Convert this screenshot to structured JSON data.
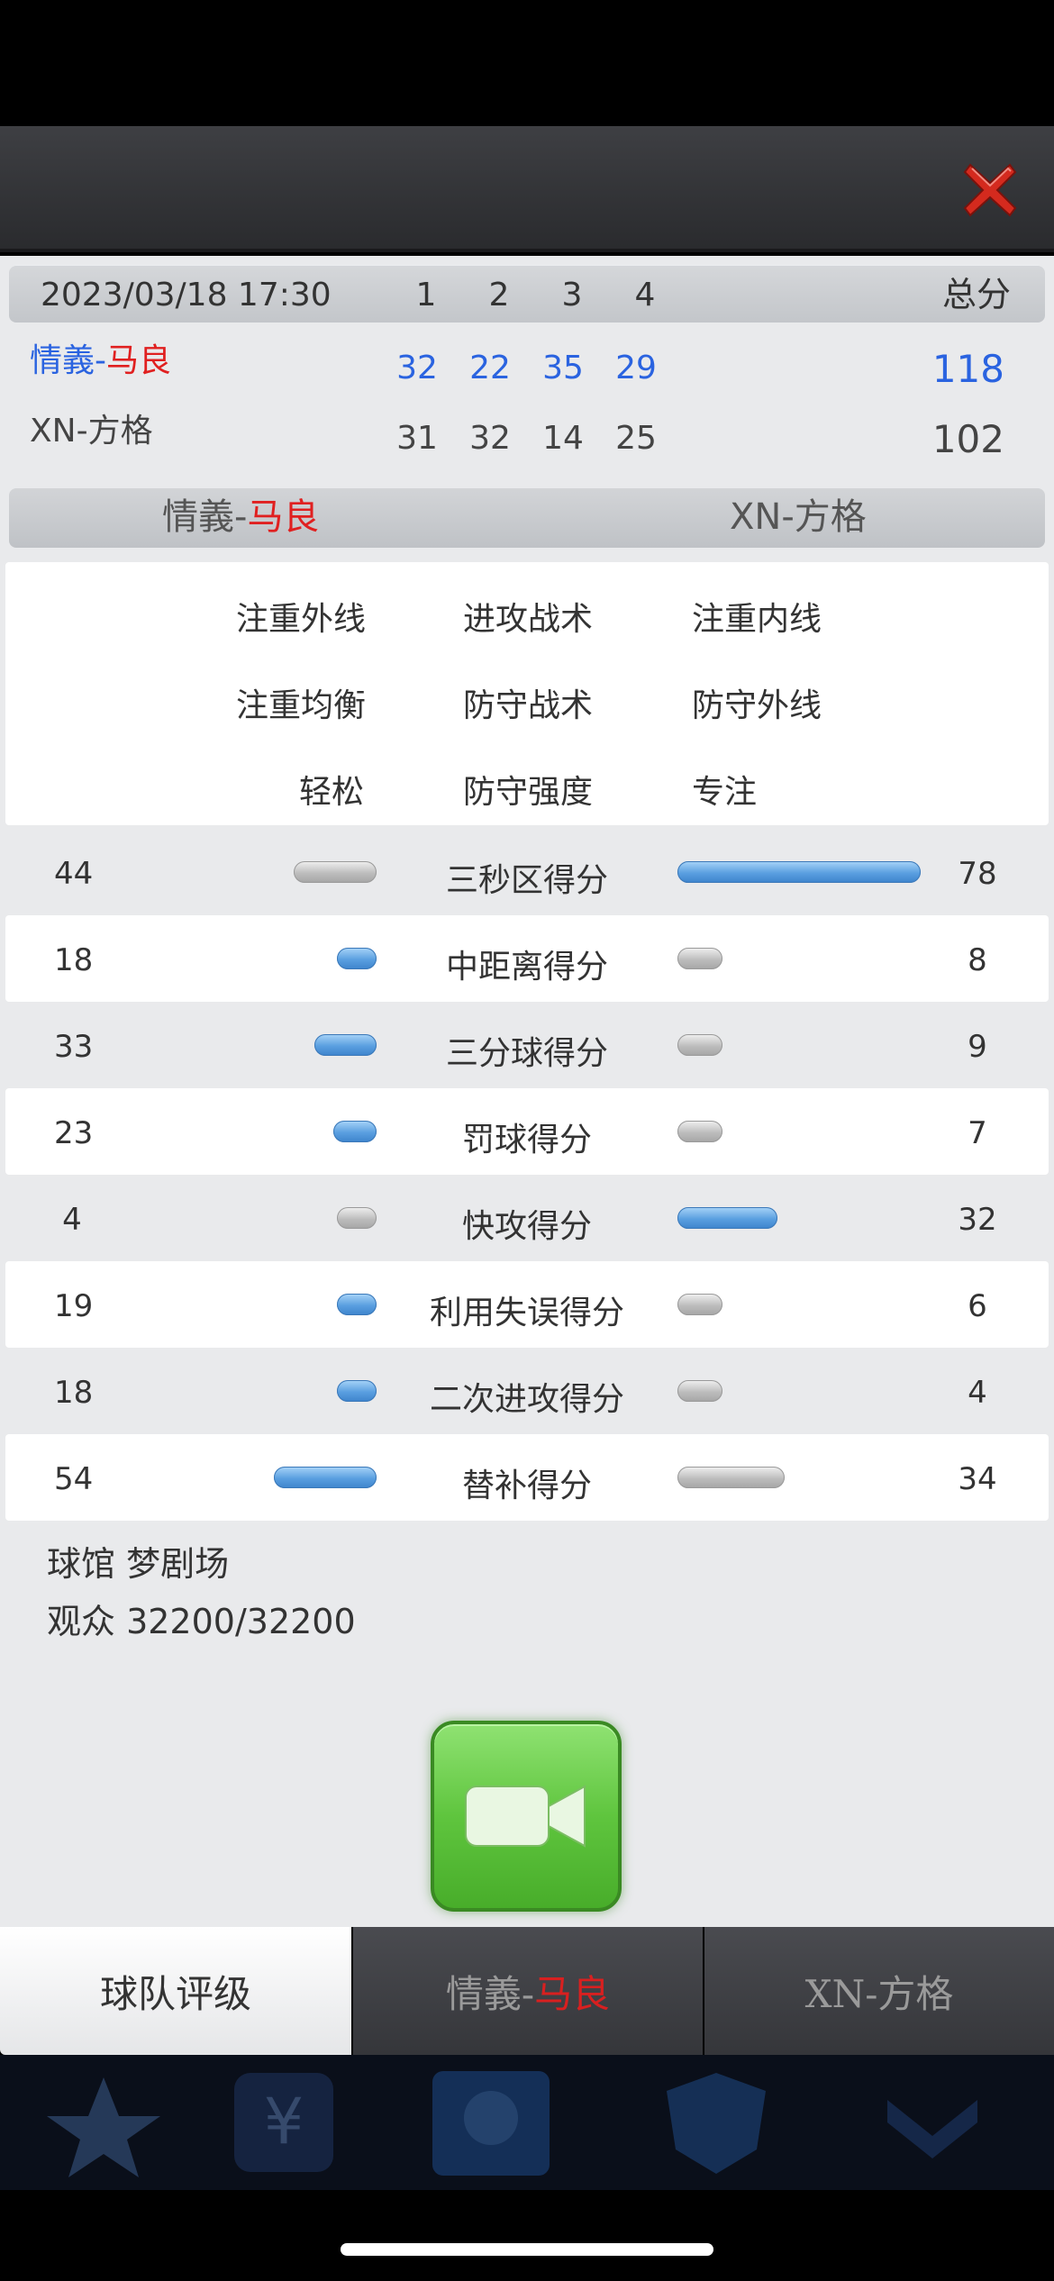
{
  "match": {
    "datetime": "2023/03/18 17:30",
    "quarters": [
      "1",
      "2",
      "3",
      "4"
    ],
    "total_label": "总分",
    "home": {
      "name_prefix": "情義-",
      "name_suffix": "马良",
      "quarters": [
        "32",
        "22",
        "35",
        "29"
      ],
      "total": "118"
    },
    "away": {
      "name": "XN-方格",
      "quarters": [
        "31",
        "32",
        "14",
        "25"
      ],
      "total": "102"
    }
  },
  "team_bar": {
    "left_prefix": "情義-",
    "left_suffix": "马良",
    "right": "XN-方格"
  },
  "tactics": [
    "注重外线",
    "进攻战术",
    "注重内线",
    "注重均衡",
    "防守战术",
    "防守外线",
    "轻松",
    "防守强度",
    "专注"
  ],
  "stats": [
    {
      "label": "三秒区得分",
      "left": "44",
      "right": "78",
      "left_frac": 0.56,
      "right_frac": 1.0,
      "left_color": "gray",
      "right_color": "blue"
    },
    {
      "label": "中距离得分",
      "left": "18",
      "right": "8",
      "left_frac": 0.23,
      "right_frac": 0.1,
      "left_color": "blue",
      "right_color": "gray"
    },
    {
      "label": "三分球得分",
      "left": "33",
      "right": "9",
      "left_frac": 0.42,
      "right_frac": 0.12,
      "left_color": "blue",
      "right_color": "gray"
    },
    {
      "label": "罚球得分",
      "left": "23",
      "right": "7",
      "left_frac": 0.29,
      "right_frac": 0.09,
      "left_color": "blue",
      "right_color": "gray"
    },
    {
      "label": "快攻得分",
      "left": "4",
      "right": "32",
      "left_frac": 0.05,
      "right_frac": 0.41,
      "left_color": "gray",
      "right_color": "blue"
    },
    {
      "label": "利用失误得分",
      "left": "19",
      "right": "6",
      "left_frac": 0.24,
      "right_frac": 0.08,
      "left_color": "blue",
      "right_color": "gray"
    },
    {
      "label": "二次进攻得分",
      "left": "18",
      "right": "4",
      "left_frac": 0.23,
      "right_frac": 0.05,
      "left_color": "blue",
      "right_color": "gray"
    },
    {
      "label": "替补得分",
      "left": "54",
      "right": "34",
      "left_frac": 0.69,
      "right_frac": 0.44,
      "left_color": "blue",
      "right_color": "gray"
    }
  ],
  "venue": {
    "arena": "球馆 梦剧场",
    "attendance": "观众 32200/32200"
  },
  "icons": {
    "close": "close-x-icon",
    "video": "video-camera-icon"
  },
  "tabs": {
    "rating": "球队评级",
    "home_prefix": "情義-",
    "home_suffix": "马良",
    "away": "XN-方格"
  }
}
